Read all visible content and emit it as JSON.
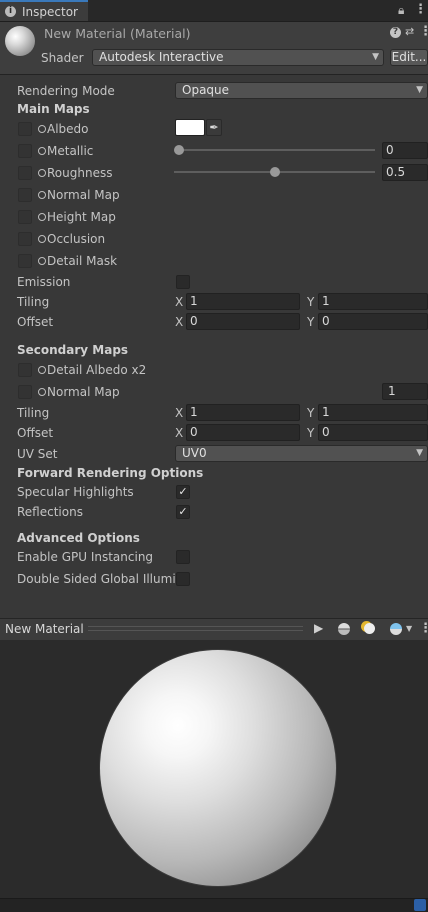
{
  "tab": {
    "label": "Inspector",
    "icon": "info-icon"
  },
  "header": {
    "title": "New Material (Material)",
    "shader_label": "Shader",
    "shader_value": "Autodesk Interactive",
    "edit_label": "Edit..."
  },
  "rendering_mode": {
    "label": "Rendering Mode",
    "value": "Opaque"
  },
  "main_maps": {
    "title": "Main Maps",
    "albedo": "Albedo",
    "metallic": "Metallic",
    "metallic_value": "0",
    "metallic_fraction": 0,
    "roughness": "Roughness",
    "roughness_value": "0.5",
    "roughness_fraction": 0.5,
    "normal_map": "Normal Map",
    "height_map": "Height Map",
    "occlusion": "Occlusion",
    "detail_mask": "Detail Mask",
    "emission": "Emission",
    "tiling": "Tiling",
    "offset": "Offset",
    "tiling_x": "1",
    "tiling_y": "1",
    "offset_x": "0",
    "offset_y": "0",
    "x_label": "X",
    "y_label": "Y",
    "albedo_color": "#ffffff"
  },
  "secondary_maps": {
    "title": "Secondary Maps",
    "detail_albedo": "Detail Albedo x2",
    "normal_map": "Normal Map",
    "normal_scale": "1",
    "tiling": "Tiling",
    "offset": "Offset",
    "tiling_x": "1",
    "tiling_y": "1",
    "offset_x": "0",
    "offset_y": "0",
    "uv_set_label": "UV Set",
    "uv_set_value": "UV0"
  },
  "forward_rendering": {
    "title": "Forward Rendering Options",
    "specular": "Specular Highlights",
    "reflections": "Reflections"
  },
  "advanced": {
    "title": "Advanced Options",
    "gpu_instancing": "Enable GPU Instancing",
    "double_sided": "Double Sided Global Illumina"
  },
  "preview": {
    "title": "New Material"
  },
  "colors": {
    "accent": "#3a79bb",
    "background": "#383838"
  }
}
